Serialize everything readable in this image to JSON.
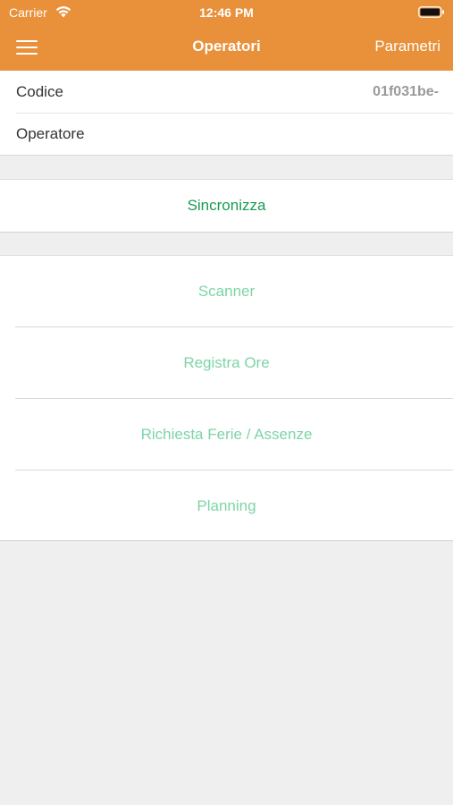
{
  "status_bar": {
    "carrier": "Carrier",
    "time": "12:46 PM",
    "wifi_icon": "wifi-icon",
    "battery_icon": "battery-icon"
  },
  "nav": {
    "menu_icon": "hamburger-menu-icon",
    "title": "Operatori",
    "right_button": "Parametri"
  },
  "info": {
    "codice_label": "Codice",
    "codice_value": "01f031be-",
    "operatore_label": "Operatore",
    "operatore_value": ""
  },
  "sync": {
    "label": "Sincronizza"
  },
  "menu": {
    "items": [
      {
        "label": "Scanner"
      },
      {
        "label": "Registra Ore"
      },
      {
        "label": "Richiesta Ferie / Assenze"
      },
      {
        "label": "Planning"
      }
    ]
  },
  "colors": {
    "header_bg": "#e8903a",
    "sync_text": "#1a9a55",
    "menu_text": "#7ed4a6",
    "page_bg": "#efeff0"
  }
}
